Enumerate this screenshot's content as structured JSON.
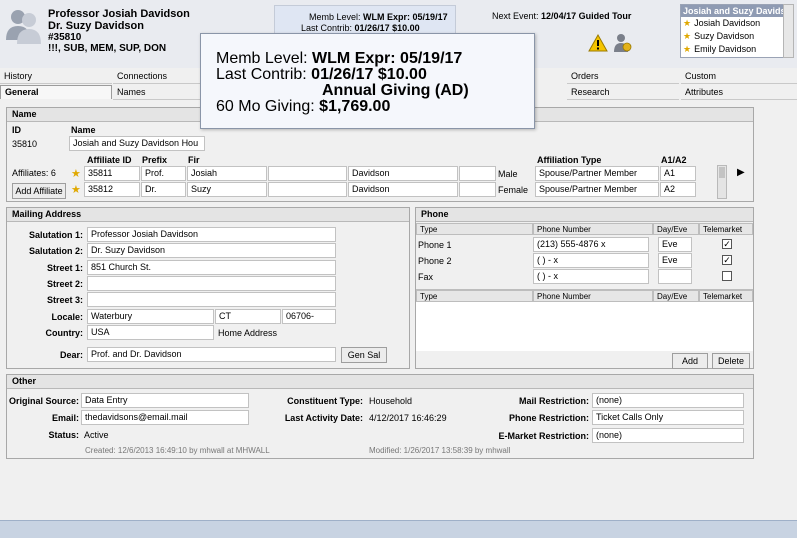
{
  "header": {
    "constituent_name": "Professor Josiah Davidson",
    "spouse_name": "Dr. Suzy Davidson",
    "id": "#35810",
    "flags": "!!!, SUB, MEM, SUP, DON",
    "memb_level_label": "Memb Level:",
    "memb_level_value": "WLM  Expr: 05/19/17",
    "last_contrib_label": "Last Contrib:",
    "last_contrib_value": "01/26/17 $10.00",
    "next_event_label": "Next Event:",
    "next_event_value": "12/04/17 Guided Tour"
  },
  "household": {
    "selected": "Josiah and Suzy Davidson",
    "members": [
      "Josiah Davidson",
      "Suzy Davidson",
      "Emily Davidson"
    ]
  },
  "tabs": {
    "history": "History",
    "general": "General",
    "connections": "Connections",
    "names": "Names",
    "orders": "Orders",
    "research": "Research",
    "custom": "Custom",
    "attributes": "Attributes"
  },
  "tooltip": {
    "memb_label": "Memb Level:",
    "memb_value": "WLM Expr: 05/19/17",
    "contrib_label": "Last Contrib:",
    "contrib_value": "01/26/17 $10.00",
    "fund": "Annual Giving (AD)",
    "giving_label": "60 Mo Giving:",
    "giving_value": "$1,769.00"
  },
  "name_panel": {
    "title": "Name",
    "id_label": "ID",
    "id_value": "35810",
    "name_label": "Name",
    "name_value": "Josiah and Suzy Davidson Hou",
    "affiliates_label": "Affiliates: 6",
    "add_affiliate": "Add Affiliate",
    "columns": {
      "affiliate_id": "Affiliate ID",
      "prefix": "Prefix",
      "first": "Fir",
      "affiliation_type": "Affiliation Type",
      "a1a2": "A1/A2"
    },
    "rows": [
      {
        "affiliate_id": "35811",
        "prefix": "Prof.",
        "first": "Josiah",
        "last": "Davidson",
        "gender": "Male",
        "type": "Spouse/Partner Member",
        "a1a2": "A1"
      },
      {
        "affiliate_id": "35812",
        "prefix": "Dr.",
        "first": "Suzy",
        "last": "Davidson",
        "gender": "Female",
        "type": "Spouse/Partner Member",
        "a1a2": "A2"
      }
    ]
  },
  "mailing": {
    "title": "Mailing Address",
    "salutation1_label": "Salutation 1:",
    "salutation1": "Professor Josiah Davidson",
    "salutation2_label": "Salutation 2:",
    "salutation2": "Dr. Suzy Davidson",
    "street1_label": "Street 1:",
    "street1": "851 Church St.",
    "street2_label": "Street 2:",
    "street3_label": "Street 3:",
    "locale_label": "Locale:",
    "city": "Waterbury",
    "state": "CT",
    "zip": "06706-",
    "country_label": "Country:",
    "country": "USA",
    "address_type": "Home Address",
    "dear_label": "Dear:",
    "dear": "Prof. and Dr. Davidson",
    "gen_sal": "Gen Sal"
  },
  "phone": {
    "title": "Phone",
    "col_type": "Type",
    "col_number": "Phone Number",
    "col_dayeve": "Day/Eve",
    "col_telemarket": "Telemarket",
    "rows": [
      {
        "type": "Phone 1",
        "number": "(213) 555-4876 x",
        "dayeve": "Eve",
        "telemarket": true
      },
      {
        "type": "Phone 2",
        "number": "(    )     -       x",
        "dayeve": "Eve",
        "telemarket": true
      },
      {
        "type": "Fax",
        "number": "(    )     -       x",
        "dayeve": "",
        "telemarket": false
      }
    ],
    "add": "Add",
    "delete": "Delete"
  },
  "other": {
    "title": "Other",
    "original_source_label": "Original Source:",
    "original_source": "Data Entry",
    "email_label": "Email:",
    "email": "thedavidsons@email.mail",
    "status_label": "Status:",
    "status": "Active",
    "constituent_type_label": "Constituent Type:",
    "constituent_type": "Household",
    "last_activity_label": "Last Activity Date:",
    "last_activity": "4/12/2017 16:46:29",
    "mail_restriction_label": "Mail Restriction:",
    "mail_restriction": "(none)",
    "phone_restriction_label": "Phone Restriction:",
    "phone_restriction": "Ticket Calls Only",
    "emarket_restriction_label": "E-Market Restriction:",
    "emarket_restriction": "(none)",
    "created": "Created: 12/6/2013 16:49:10 by mhwall at MHWALL",
    "modified": "Modified: 1/26/2017 13:58:39 by mhwall"
  },
  "colors": {
    "accent": "#8f9bb3",
    "tooltip_border": "#8a95a8",
    "header_bg": "#e9ebf0"
  },
  "icons": [
    "people-icon",
    "warning-icon",
    "donor-icon",
    "star-icon",
    "arrow-right-icon"
  ]
}
